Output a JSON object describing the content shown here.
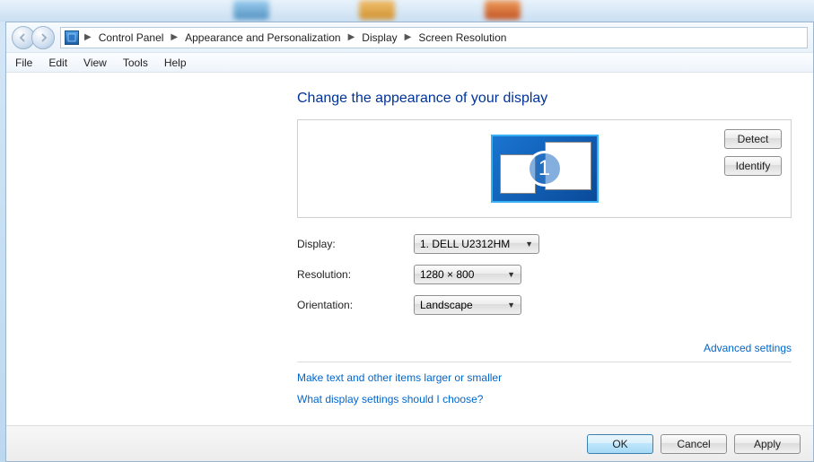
{
  "breadcrumb": {
    "items": [
      "Control Panel",
      "Appearance and Personalization",
      "Display",
      "Screen Resolution"
    ]
  },
  "menu": {
    "file": "File",
    "edit": "Edit",
    "view": "View",
    "tools": "Tools",
    "help": "Help"
  },
  "page": {
    "title": "Change the appearance of your display",
    "monitor_number": "1",
    "detect_btn": "Detect",
    "identify_btn": "Identify"
  },
  "form": {
    "display_label": "Display:",
    "display_value": "1. DELL U2312HM",
    "resolution_label": "Resolution:",
    "resolution_value": "1280 × 800",
    "orientation_label": "Orientation:",
    "orientation_value": "Landscape"
  },
  "links": {
    "advanced": "Advanced settings",
    "larger_text": "Make text and other items larger or smaller",
    "which_settings": "What display settings should I choose?"
  },
  "footer": {
    "ok": "OK",
    "cancel": "Cancel",
    "apply": "Apply"
  }
}
